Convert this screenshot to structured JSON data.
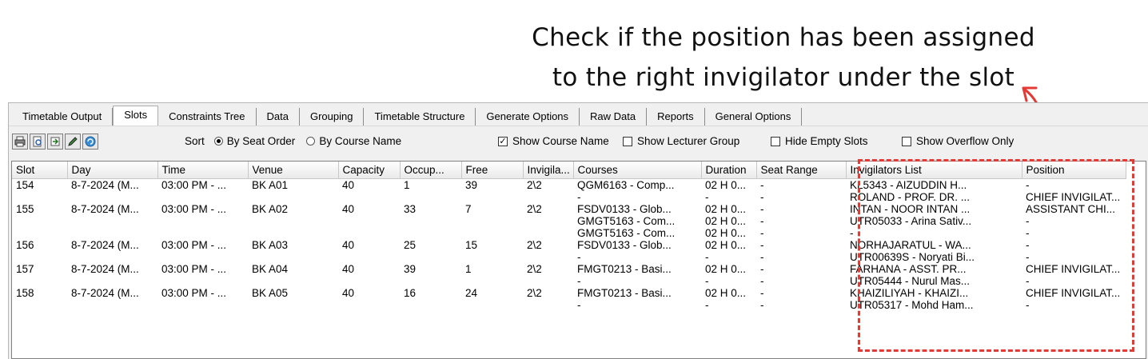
{
  "annotation": {
    "line1": "Check if the position has been assigned",
    "line2": "to the right invigilator under the slot",
    "color": "#e53935"
  },
  "tabs": [
    "Timetable Output",
    "Slots",
    "Constraints Tree",
    "Data",
    "Grouping",
    "Timetable Structure",
    "Generate Options",
    "Raw Data",
    "Reports",
    "General Options"
  ],
  "active_tab": "Slots",
  "toolbar": {
    "icons": [
      "printer-icon",
      "print-preview-icon",
      "export-icon",
      "edit-pencil-icon",
      "refresh-icon"
    ]
  },
  "sort": {
    "label": "Sort",
    "by_seat_order": "By Seat Order",
    "by_course_name": "By Course Name",
    "selected": "By Seat Order"
  },
  "options": {
    "show_course_name": {
      "label": "Show Course Name",
      "checked": true
    },
    "show_lecturer_group": {
      "label": "Show Lecturer Group",
      "checked": false
    },
    "hide_empty_slots": {
      "label": "Hide Empty Slots",
      "checked": false
    },
    "show_overflow_only": {
      "label": "Show Overflow Only",
      "checked": false
    }
  },
  "columns": [
    "Slot",
    "Day",
    "Time",
    "Venue",
    "Capacity",
    "Occup...",
    "Free",
    "Invigila...",
    "Courses",
    "Duration",
    "Seat Range",
    "Invigilators List",
    "Position"
  ],
  "rows": [
    [
      "154",
      "8-7-2024 (M...",
      "03:00 PM - ...",
      "BK A01",
      "40",
      "1",
      "39",
      "2\\2",
      "QGM6163 - Comp...",
      "02 H 0...",
      "-",
      "KL5343 - AIZUDDIN H...",
      "-"
    ],
    [
      "",
      "",
      "",
      "",
      "",
      "",
      "",
      "",
      "-",
      "-",
      "-",
      "ROLAND - PROF. DR. ...",
      "CHIEF INVIGILAT..."
    ],
    [
      "155",
      "8-7-2024 (M...",
      "03:00 PM - ...",
      "BK A02",
      "40",
      "33",
      "7",
      "2\\2",
      "FSDV0133 - Glob...",
      "02 H 0...",
      "-",
      "INTAN - NOOR INTAN ...",
      "ASSISTANT CHI..."
    ],
    [
      "",
      "",
      "",
      "",
      "",
      "",
      "",
      "",
      "GMGT5163 - Com...",
      "02 H 0...",
      "-",
      "UTR05033 - Arina Sativ...",
      "-"
    ],
    [
      "",
      "",
      "",
      "",
      "",
      "",
      "",
      "",
      "GMGT5163 - Com...",
      "02 H 0...",
      "-",
      "-",
      "-"
    ],
    [
      "156",
      "8-7-2024 (M...",
      "03:00 PM - ...",
      "BK A03",
      "40",
      "25",
      "15",
      "2\\2",
      "FSDV0133 - Glob...",
      "02 H 0...",
      "-",
      "NORHAJARATUL - WA...",
      "-"
    ],
    [
      "",
      "",
      "",
      "",
      "",
      "",
      "",
      "",
      "-",
      "-",
      "-",
      "UTR00639S - Noryati Bi...",
      "-"
    ],
    [
      "157",
      "8-7-2024 (M...",
      "03:00 PM - ...",
      "BK A04",
      "40",
      "39",
      "1",
      "2\\2",
      "FMGT0213 - Basi...",
      "02 H 0...",
      "-",
      "FARHANA - ASST. PR...",
      "CHIEF INVIGILAT..."
    ],
    [
      "",
      "",
      "",
      "",
      "",
      "",
      "",
      "",
      "-",
      "-",
      "-",
      "UTR05444 - Nurul Mas...",
      "-"
    ],
    [
      "158",
      "8-7-2024 (M...",
      "03:00 PM - ...",
      "BK A05",
      "40",
      "16",
      "24",
      "2\\2",
      "FMGT0213 - Basi...",
      "02 H 0...",
      "-",
      "KHAIZILIYAH - KHAIZI...",
      "CHIEF INVIGILAT..."
    ],
    [
      "",
      "",
      "",
      "",
      "",
      "",
      "",
      "",
      "-",
      "-",
      "-",
      "UTR05317 - Mohd Ham...",
      "-"
    ]
  ]
}
